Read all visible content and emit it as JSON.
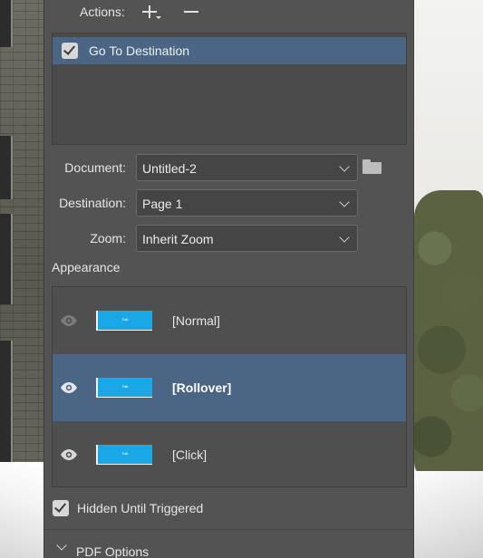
{
  "actions": {
    "label": "Actions:",
    "add_icon": "plus-with-caret-icon",
    "remove_icon": "minus-icon",
    "list": [
      {
        "label": "Go To Destination",
        "checked": true,
        "selected": true
      }
    ]
  },
  "fields": {
    "document": {
      "label": "Document:",
      "value": "Untitled-2",
      "icon": "folder-icon"
    },
    "destination": {
      "label": "Destination:",
      "value": "Page 1"
    },
    "zoom": {
      "label": "Zoom:",
      "value": "Inherit Zoom"
    }
  },
  "appearance": {
    "title": "Appearance",
    "states": [
      {
        "label": "[Normal]",
        "thumb_text": "Talk",
        "selected": false
      },
      {
        "label": "[Rollover]",
        "thumb_text": "Talk",
        "selected": true
      },
      {
        "label": "[Click]",
        "thumb_text": "Talk",
        "selected": false
      }
    ]
  },
  "hidden_until_triggered": {
    "label": "Hidden Until Triggered",
    "checked": true
  },
  "pdf_options": {
    "label": "PDF Options",
    "expanded": false
  },
  "colors": {
    "panel_bg": "#535353",
    "selection": "#4b6584",
    "button_thumb": "#1aa7e8"
  }
}
